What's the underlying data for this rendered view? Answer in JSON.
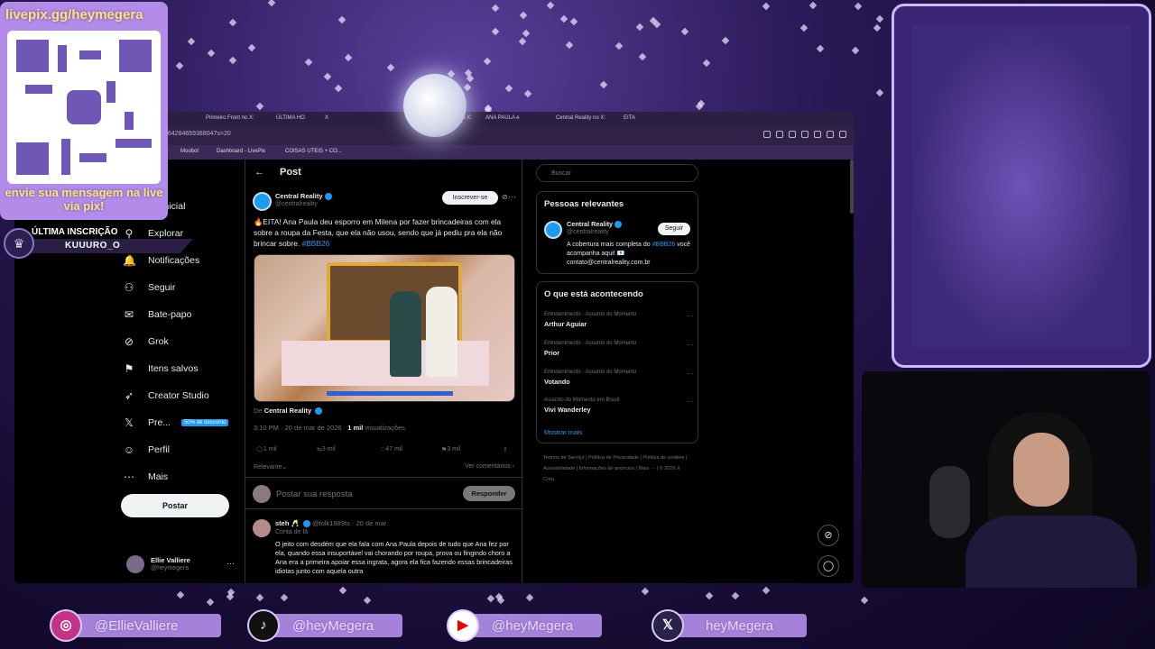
{
  "qr": {
    "url": "livepix.gg/heymegera",
    "message": "envie sua mensagem na live via pix!"
  },
  "subscriber": {
    "label": "ÚLTIMA INSCRIÇÃO",
    "name": "KUUURO_O"
  },
  "browser": {
    "tabs": [
      "Primeiro Front no X:",
      "ÚLTIMA HO",
      "X",
      "no X:",
      "ANA PAULA e",
      "Central Reality no X:",
      "EITA"
    ],
    "url": "564284659388047s=20",
    "bookmarks": [
      "Moobot",
      "Dashboard - LivePix",
      "COISAS UTEIS + CO..."
    ]
  },
  "nav": {
    "items": [
      {
        "label": "na Inicial",
        "icon": "home-icon"
      },
      {
        "label": "Explorar",
        "icon": "search-icon"
      },
      {
        "label": "Notificações",
        "icon": "bell-icon"
      },
      {
        "label": "Seguir",
        "icon": "follow-icon"
      },
      {
        "label": "Bate-papo",
        "icon": "chat-icon"
      },
      {
        "label": "Grok",
        "icon": "grok-icon"
      },
      {
        "label": "Itens salvos",
        "icon": "bookmark-icon"
      },
      {
        "label": "Creator Studio",
        "icon": "rocket-icon"
      },
      {
        "label": "Pre...",
        "icon": "x-logo-icon",
        "badge": "50% de desconto"
      },
      {
        "label": "Perfil",
        "icon": "person-icon"
      },
      {
        "label": "Mais",
        "icon": "more-icon"
      }
    ],
    "post_button": "Postar",
    "me": {
      "name": "Ellie Valliere",
      "handle": "@heymegera"
    }
  },
  "post": {
    "header": "Post",
    "author": {
      "name": "Central Reality",
      "handle": "@centralreality"
    },
    "subscribe": "Inscrever-se",
    "text": "🔥EITA! Ana Paula deu esporro em Milena por fazer brincadeiras com ela sobre a roupa da Festa, que ela não usou, sendo que já pediu pra ela não brincar sobre.",
    "hashtag": "#BBB26",
    "from_prefix": "De",
    "from_name": "Central Reality",
    "time": "3:10 PM · 20 de mar de 2026 ·",
    "views_count": "1 mil",
    "views_label": "visualizações",
    "stats": {
      "replies": "1 mil",
      "reposts": "3 mil",
      "likes": "47 mil",
      "bookmarks": "3 mil"
    },
    "relevance": "Relevante",
    "see_comments": "Ver comentários",
    "reply_placeholder": "Postar sua resposta",
    "reply_button": "Responder"
  },
  "comment": {
    "name": "steh 🥂",
    "handle": "@folk1989ts · 20 de mar",
    "label": "Conta de fã",
    "text": "O jeito com desdém que ela fala com Ana Paula depois de tudo que Ana fez por ela, quando essa insuportável vai chorando por roupa, prova ou fingindo choro a Ana era a primeira apoiar essa ingrata, agora ela fica fazendo essas brincadeiras idiotas junto com aquela outra"
  },
  "sidebar": {
    "search_placeholder": "Buscar",
    "relevant_title": "Pessoas relevantes",
    "person": {
      "name": "Central Reality",
      "handle": "@centralreality",
      "follow": "Seguir",
      "bio1": "A cobertura mais completa do",
      "bio_tag": "#BBB26",
      "bio2": "você acompanha aqui! 📧",
      "bio3": "contato@centralreality.com.br"
    },
    "trending_title": "O que está acontecendo",
    "trends": [
      {
        "context": "Entretenimento · Assunto do Momento",
        "topic": "Arthur Aguiar"
      },
      {
        "context": "Entretenimento · Assunto do Momento",
        "topic": "Prior"
      },
      {
        "context": "Entretenimento · Assunto do Momento",
        "topic": "Votando"
      },
      {
        "context": "Assunto do Momento em Brasil",
        "topic": "Vivi Wanderley"
      }
    ],
    "show_more": "Mostrar mais",
    "footer": "Termos de Serviço | Política de Privacidade | Política de cookies | Acessibilidade | Informações de anúncios | Mais ··· | © 2026 X Corp."
  },
  "socials": [
    {
      "platform": "instagram-icon",
      "handle": "@EllieValliere"
    },
    {
      "platform": "tiktok-icon",
      "handle": "@heyMegera"
    },
    {
      "platform": "youtube-icon",
      "handle": "@heyMegera"
    },
    {
      "platform": "x-icon",
      "handle": "heyMegera"
    }
  ]
}
